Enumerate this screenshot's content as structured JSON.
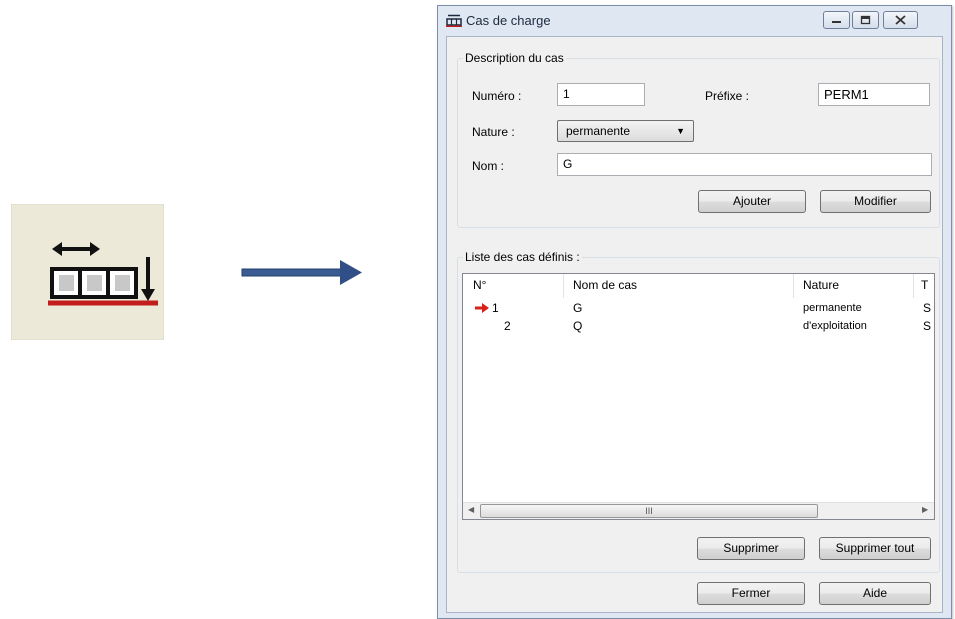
{
  "window": {
    "title": "Cas de charge",
    "caption_buttons": [
      "minimize",
      "maximize",
      "close"
    ]
  },
  "toolbar_icon": {
    "name": "load-cases-icon"
  },
  "description_group": {
    "legend": "Description du cas",
    "numero_label": "Numéro :",
    "numero_value": "1",
    "prefixe_label": "Préfixe :",
    "prefixe_value": "PERM1",
    "nature_label": "Nature :",
    "nature_value": "permanente",
    "nom_label": "Nom :",
    "nom_value": "G",
    "ajouter_label": "Ajouter",
    "modifier_label": "Modifier"
  },
  "list_group": {
    "legend": "Liste des cas définis :",
    "columns": [
      "N°",
      "Nom de cas",
      "Nature",
      "T"
    ],
    "rows": [
      {
        "num": "1",
        "nom": "G",
        "nature": "permanente",
        "t": "S",
        "current": true
      },
      {
        "num": "2",
        "nom": "Q",
        "nature": "d'exploitation",
        "t": "S",
        "current": false
      }
    ],
    "scrollbar_grip": "III",
    "supprimer_label": "Supprimer",
    "supprimer_tout_label": "Supprimer tout"
  },
  "footer": {
    "fermer_label": "Fermer",
    "aide_label": "Aide"
  },
  "colors": {
    "current_row_arrow": "#d9201d",
    "pointer_arrow": "#2f4f86",
    "window_frame": "#dfe7f2"
  }
}
